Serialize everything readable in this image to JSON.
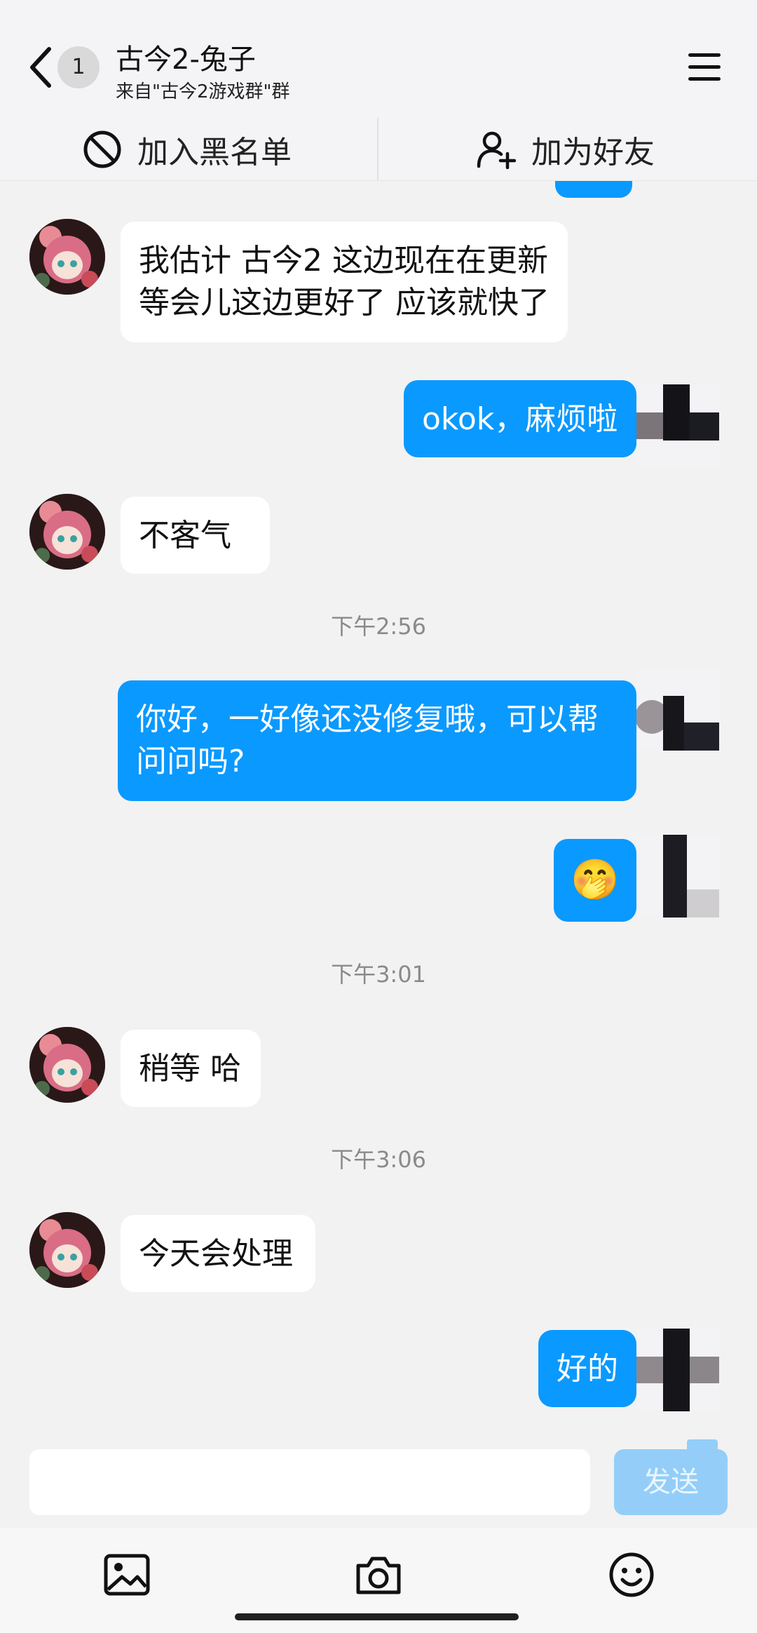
{
  "header": {
    "back_icon": "chevron-left-icon",
    "unread_count": "1",
    "title": "古今2-兔子",
    "subtitle": "来自\"古今2游戏群\"群",
    "menu_icon": "hamburger-menu-icon"
  },
  "actions": {
    "block": {
      "label": "加入黑名单",
      "icon": "block-icon"
    },
    "add_friend": {
      "label": "加为好友",
      "icon": "add-user-icon"
    }
  },
  "messages": [
    {
      "side": "in",
      "text_lines": [
        "我估计  古今2 这边现在在更新",
        "等会儿这边更好了  应该就快了"
      ]
    },
    {
      "side": "out",
      "text_lines": [
        "okok，麻烦啦"
      ]
    },
    {
      "side": "in",
      "text_lines": [
        "不客气"
      ]
    },
    {
      "side": "time",
      "text": "下午2:56"
    },
    {
      "side": "out",
      "text_lines": [
        "你好，一好像还没修复哦，可以帮",
        "问问吗?"
      ]
    },
    {
      "side": "out",
      "emoji": "🤭"
    },
    {
      "side": "time",
      "text": "下午3:01"
    },
    {
      "side": "in",
      "text_lines": [
        "稍等 哈"
      ]
    },
    {
      "side": "time",
      "text": "下午3:06"
    },
    {
      "side": "in",
      "text_lines": [
        "今天会处理"
      ]
    },
    {
      "side": "out",
      "text_lines": [
        "好的"
      ]
    }
  ],
  "composer": {
    "input_value": "",
    "send_label": "发送"
  },
  "toolbar": {
    "icons": [
      "image-icon",
      "camera-icon",
      "emoji-icon"
    ]
  },
  "colors": {
    "accent": "#0a99ff",
    "send_disabled": "#94cef8",
    "background": "#f2f2f2"
  }
}
